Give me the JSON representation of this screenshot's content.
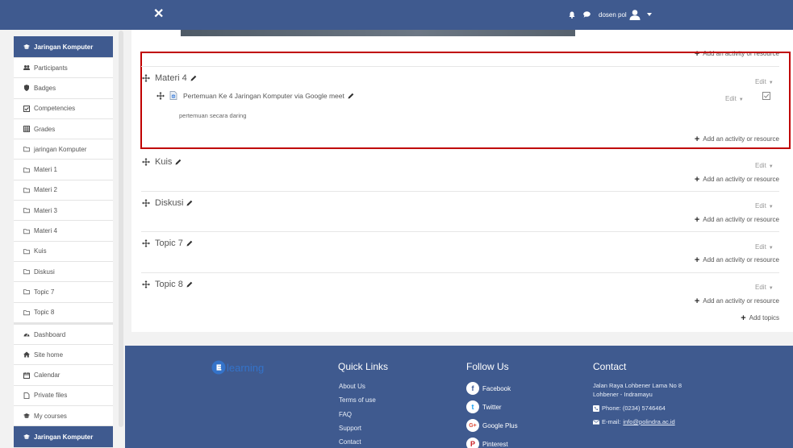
{
  "navbar": {
    "close_glyph": "✕",
    "user_name": "dosen pol",
    "icons": [
      "bell-icon",
      "chat-icon",
      "avatar-icon",
      "caret-down-icon"
    ]
  },
  "sidebar": {
    "course_title": "Jaringan Komputer",
    "items": [
      {
        "label": "Participants",
        "icon": "users-icon"
      },
      {
        "label": "Badges",
        "icon": "shield-icon"
      },
      {
        "label": "Competencies",
        "icon": "checkbox-icon"
      },
      {
        "label": "Grades",
        "icon": "table-icon"
      },
      {
        "label": "jaringan Komputer",
        "icon": "folder-icon"
      },
      {
        "label": "Materi 1",
        "icon": "folder-icon"
      },
      {
        "label": "Materi 2",
        "icon": "folder-icon"
      },
      {
        "label": "Materi 3",
        "icon": "folder-icon"
      },
      {
        "label": "Materi 4",
        "icon": "folder-icon"
      },
      {
        "label": "Kuis",
        "icon": "folder-icon"
      },
      {
        "label": "Diskusi",
        "icon": "folder-icon"
      },
      {
        "label": "Topic 7",
        "icon": "folder-icon"
      },
      {
        "label": "Topic 8",
        "icon": "folder-icon"
      }
    ],
    "nav_items": [
      {
        "label": "Dashboard",
        "icon": "dashboard-icon"
      },
      {
        "label": "Site home",
        "icon": "home-icon"
      },
      {
        "label": "Calendar",
        "icon": "calendar-icon"
      },
      {
        "label": "Private files",
        "icon": "file-icon"
      },
      {
        "label": "My courses",
        "icon": "graduation-cap-icon"
      }
    ],
    "bottom_course_title": "Jaringan Komputer"
  },
  "content": {
    "add_activity_label": "Add an activity or resource",
    "edit_label": "Edit",
    "add_topics_label": "Add topics",
    "sections": [
      {
        "title": "Materi 4"
      },
      {
        "title": "Kuis"
      },
      {
        "title": "Diskusi"
      },
      {
        "title": "Topic 7"
      },
      {
        "title": "Topic 8"
      }
    ],
    "activity": {
      "title": "Pertemuan Ke 4 Jaringan Komputer via Google meet",
      "description": "pertemuan secara daring",
      "edit_label": "Edit"
    }
  },
  "footer": {
    "logo_text": "learning",
    "quick_links": {
      "title": "Quick Links",
      "items": [
        "About Us",
        "Terms of use",
        "FAQ",
        "Support",
        "Contact"
      ]
    },
    "follow_us": {
      "title": "Follow Us",
      "items": [
        {
          "label": "Facebook",
          "glyph": "f",
          "color": "#3b5998"
        },
        {
          "label": "Twitter",
          "glyph": "t",
          "color": "#1da1f2"
        },
        {
          "label": "Google Plus",
          "glyph": "G+",
          "color": "#dd4b39"
        },
        {
          "label": "Pinterest",
          "glyph": "P",
          "color": "#cb2027"
        }
      ]
    },
    "contact": {
      "title": "Contact",
      "address_line1": "Jalan Raya Lohbener Lama No 8",
      "address_line2": "Lohbener - Indramayu",
      "phone": "Phone: (0234) 5746464",
      "email_label": "E-mail:",
      "email": "info@polindra.ac.id"
    }
  },
  "colors": {
    "brand": "#3f5a8f",
    "highlight": "#c00000",
    "logo_blue": "#3473c9"
  }
}
